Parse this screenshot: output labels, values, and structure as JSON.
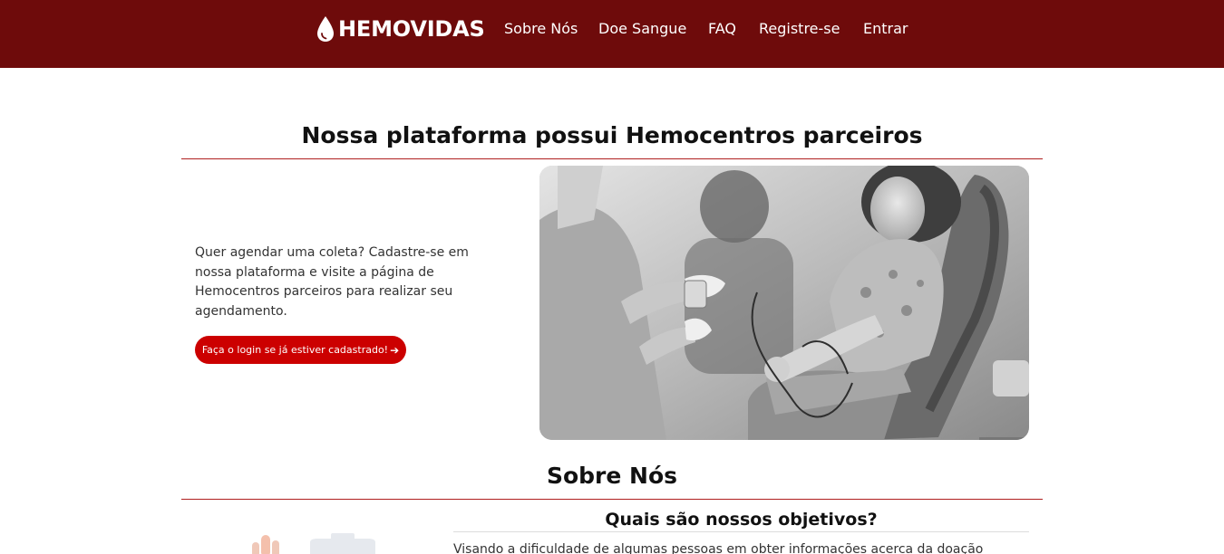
{
  "header": {
    "brand": "HEMOVIDAS",
    "nav": [
      {
        "label": "Sobre Nós"
      },
      {
        "label": "Doe Sangue"
      },
      {
        "label": "FAQ"
      },
      {
        "label": "Registre-se"
      },
      {
        "label": "Entrar"
      }
    ],
    "background_color": "#6e0b0b",
    "logo_icon": "blood-drop-icon"
  },
  "partners_section": {
    "title": "Nossa plataforma possui Hemocentros parceiros",
    "description": "Quer agendar uma coleta? Cadastre-se em nossa plataforma e visite a página de Hemocentros parceiros para realizar seu agendamento.",
    "login_button": "Faça o login se já estiver cadastrado!",
    "login_button_icon": "arrow-right-icon",
    "button_color": "#cc0000",
    "image_alt": "blood-donation-photo"
  },
  "about_section": {
    "title": "Sobre Nós",
    "subtitle": "Quais são nossos objetivos?",
    "body": "Visando a dificuldade de algumas pessoas em obter informações acerca da doação"
  },
  "accent_rule_color": "#b02020"
}
